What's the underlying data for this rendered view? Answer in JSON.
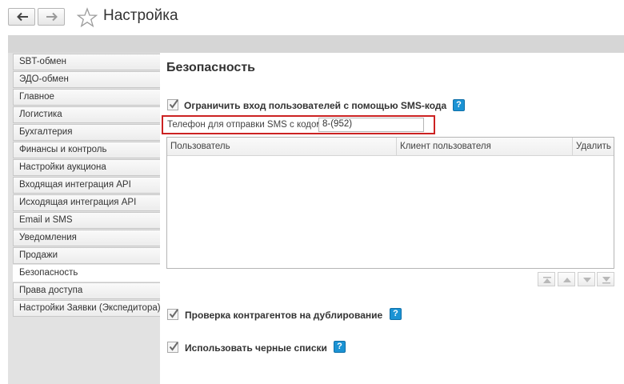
{
  "header": {
    "title": "Настройка"
  },
  "sidebar": {
    "items": [
      {
        "label": "SBT-обмен"
      },
      {
        "label": "ЭДО-обмен"
      },
      {
        "label": "Главное"
      },
      {
        "label": "Логистика"
      },
      {
        "label": "Бухгалтерия"
      },
      {
        "label": "Финансы и контроль"
      },
      {
        "label": "Настройки аукциона"
      },
      {
        "label": "Входящая интеграция API"
      },
      {
        "label": "Исходящая интеграция API"
      },
      {
        "label": "Email и SMS"
      },
      {
        "label": "Уведомления"
      },
      {
        "label": "Продажи"
      },
      {
        "label": "Безопасность"
      },
      {
        "label": "Права доступа"
      },
      {
        "label": "Настройки Заявки (Экспедитора)"
      }
    ],
    "active_index": 12
  },
  "main": {
    "section_title": "Безопасность",
    "sms_restrict": {
      "label": "Ограничить вход пользователей с помощью SMS-кода",
      "checked": true
    },
    "phone": {
      "label": "Телефон для отправки SMS с кодом:",
      "value": "8-(952)"
    },
    "table": {
      "columns": [
        "Пользователь",
        "Клиент пользователя",
        "Удалить"
      ],
      "rows": []
    },
    "dup_check": {
      "label": "Проверка контрагентов на дублирование",
      "checked": true
    },
    "blacklists": {
      "label": "Использовать черные списки",
      "checked": true
    },
    "help_glyph": "?"
  },
  "colors": {
    "highlight": "#cc2222",
    "help": "#1b93d4",
    "active_tab": "#ffffff"
  },
  "icons": [
    "back-arrow-icon",
    "forward-arrow-icon",
    "star-icon",
    "checkmark-icon",
    "help-icon",
    "move-first-icon",
    "move-up-icon",
    "move-down-icon",
    "move-last-icon"
  ]
}
